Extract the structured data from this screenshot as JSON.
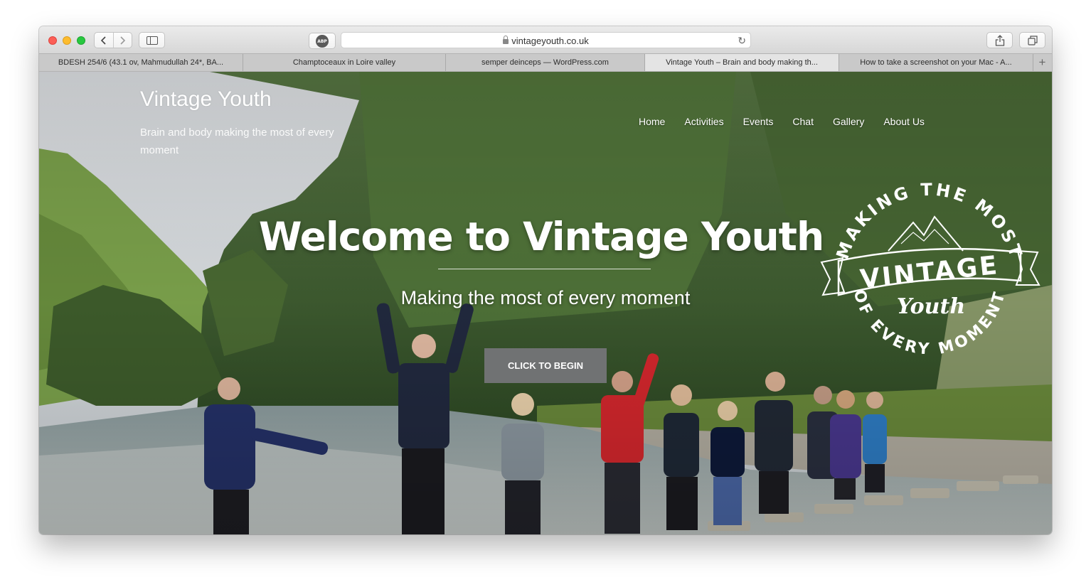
{
  "browser": {
    "url": "vintageyouth.co.uk",
    "tabs": [
      {
        "title": "BDESH 254/6 (43.1 ov, Mahmudullah 24*, BA...",
        "active": false
      },
      {
        "title": "Champtoceaux in Loire valley",
        "active": false
      },
      {
        "title": "semper deinceps — WordPress.com",
        "active": false
      },
      {
        "title": "Vintage Youth – Brain and body making th...",
        "active": true
      },
      {
        "title": "How to take a screenshot on your Mac - A...",
        "active": false
      }
    ],
    "adblock_label": "ABP",
    "new_tab_symbol": "+"
  },
  "site": {
    "title": "Vintage Youth",
    "tagline": "Brain and body making the most of every moment",
    "nav": [
      "Home",
      "Activities",
      "Events",
      "Chat",
      "Gallery",
      "About Us"
    ]
  },
  "hero": {
    "title": "Welcome to Vintage Youth",
    "subtitle": "Making the most of every moment",
    "cta_label": "CLICK TO BEGIN"
  },
  "badge": {
    "arc_top": "MAKING THE MOST",
    "banner": "VINTAGE",
    "script": "Youth",
    "arc_bottom": "OF EVERY MOMENT"
  },
  "colors": {
    "cta_bg": "#707273",
    "sky": "#d8dde2",
    "hill": "#7aa84a",
    "forest": "#3f5e2c",
    "water": "#a7b4b4",
    "path": "#b4b0a5"
  }
}
